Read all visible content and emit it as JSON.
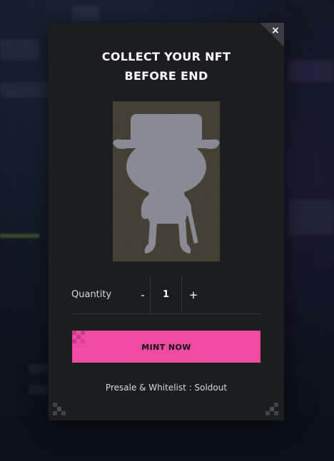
{
  "modal": {
    "title_line1": "COLLECT YOUR NFT",
    "title_line2": "BEFORE END",
    "close_symbol": "×",
    "image_icon": "character-silhouette",
    "quantity": {
      "label": "Quantity",
      "decrement": "-",
      "value": "1",
      "increment": "+"
    },
    "mint_button_label": "MINT NOW",
    "status_text": "Presale & Whitelist : Soldout"
  },
  "colors": {
    "modal_bg": "#1b1d21",
    "accent_pink": "#f04ba1",
    "page_bg": "#0c111a",
    "silhouette": "#8a8a96"
  },
  "icons": [
    "close-icon",
    "nft-silhouette-icon",
    "pixel-corner-icon"
  ]
}
